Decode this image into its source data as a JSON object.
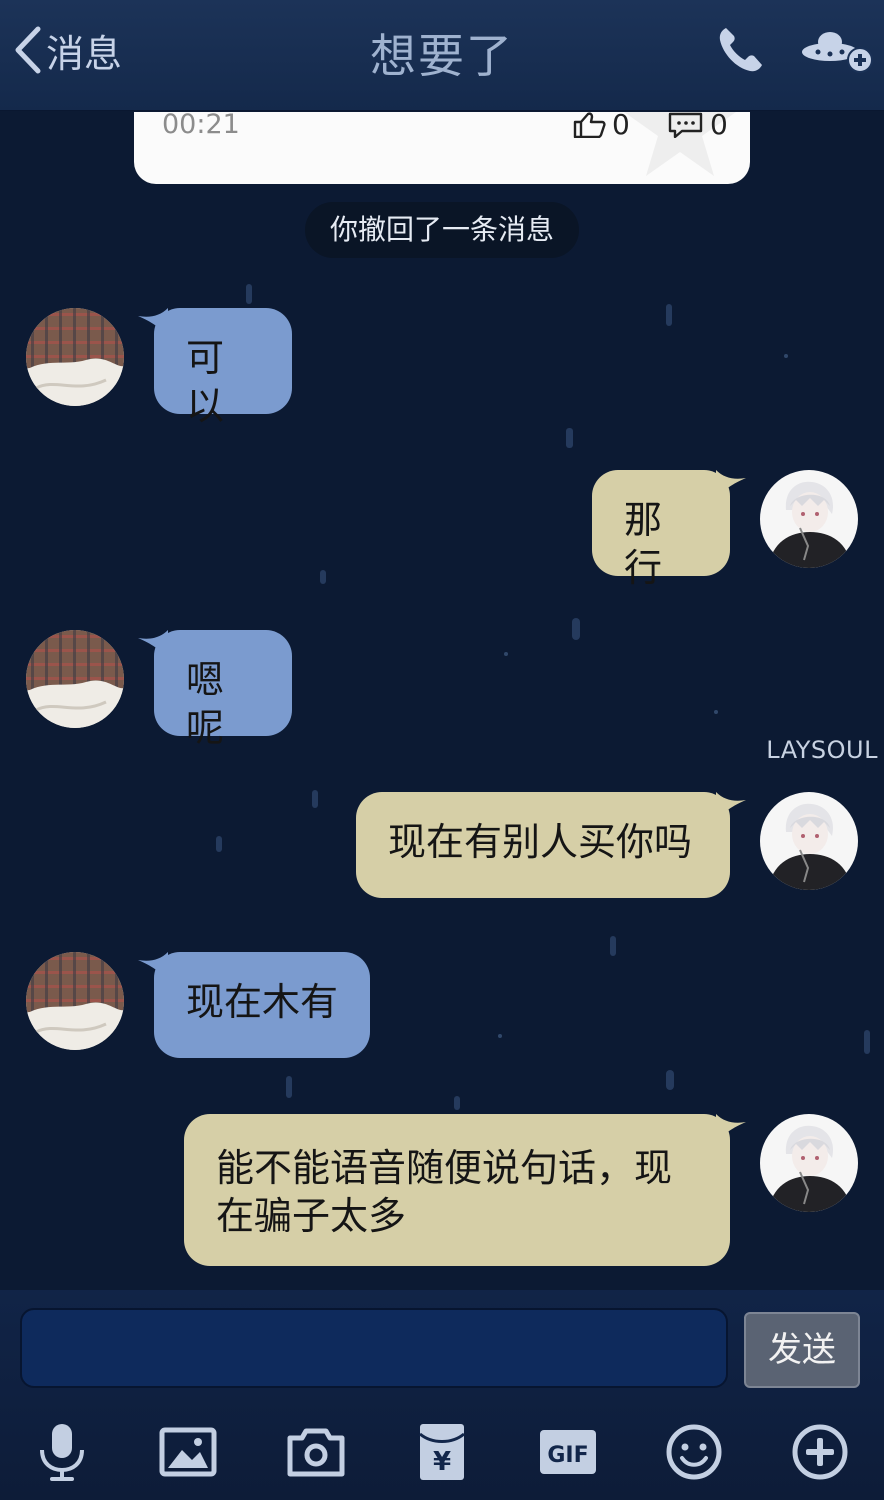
{
  "header": {
    "back_label": "消息",
    "title": "想要了"
  },
  "shared_card": {
    "time": "00:21",
    "likes": "0",
    "comments": "0"
  },
  "notice": "你撤回了一条消息",
  "messages": [
    {
      "side": "in",
      "text": "可以"
    },
    {
      "side": "out",
      "text": "那行"
    },
    {
      "side": "in",
      "text": "嗯呢"
    },
    {
      "side": "out",
      "text": "现在有别人买你吗"
    },
    {
      "side": "in",
      "text": "现在木有"
    },
    {
      "side": "out",
      "text": "能不能语音随便说句话，现在骗子太多"
    }
  ],
  "watermark": "LAYSOUL",
  "composer": {
    "input_value": "",
    "send_label": "发送"
  },
  "toolbar": [
    "microphone-icon",
    "image-icon",
    "camera-icon",
    "red-packet-icon",
    "gif-icon",
    "emoji-icon",
    "plus-icon"
  ],
  "colors": {
    "background": "#0c1a33",
    "header": "#1c3358",
    "bubble_in": "#7b9bcf",
    "bubble_out": "#d6cfa7",
    "send_button": "#5a6373",
    "input": "#0e2a5c"
  }
}
